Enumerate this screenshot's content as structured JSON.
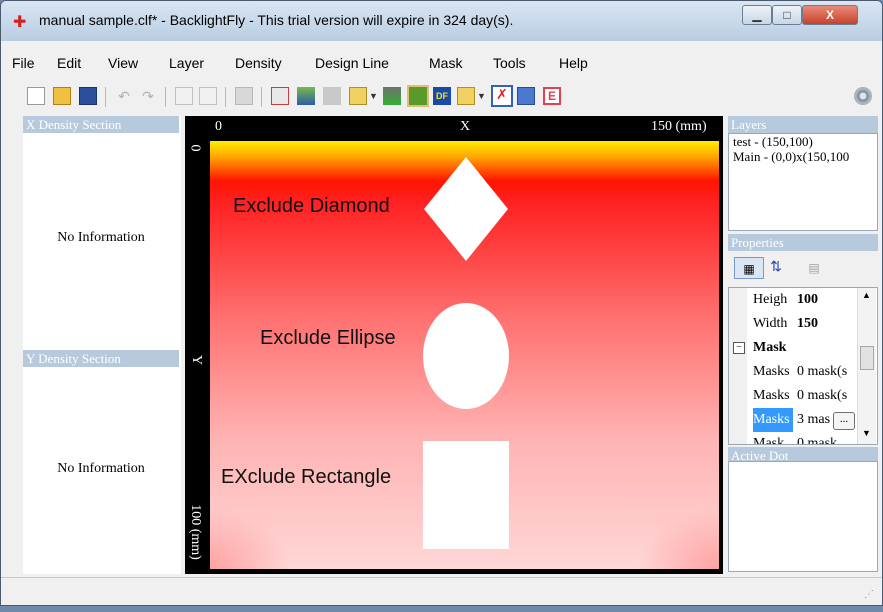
{
  "window": {
    "title": "manual sample.clf* - BacklightFly - This trial version will expire in 324 day(s).",
    "controls": {
      "minimize": "▁",
      "maximize": "□",
      "close": "X"
    }
  },
  "menu": [
    "File",
    "Edit",
    "View",
    "Layer",
    "Density",
    "Design Line",
    "Mask",
    "Tools",
    "Help"
  ],
  "left_panel": {
    "x_section_title": "X Density Section",
    "x_section_text": "No Information",
    "y_section_title": "Y Density Section",
    "y_section_text": "No Information"
  },
  "canvas": {
    "x_ruler": {
      "start": "0",
      "label": "X",
      "end": "150 (mm)"
    },
    "y_ruler": {
      "start": "0",
      "label": "Y",
      "end": "100 (mm)"
    },
    "shapes": {
      "diamond_label": "Exclude Diamond",
      "ellipse_label": "Exclude Ellipse",
      "rectangle_label": "EXclude Rectangle"
    }
  },
  "layers": {
    "title": "Layers",
    "items": [
      "test - (150,100)",
      "Main - (0,0)x(150,100"
    ]
  },
  "properties": {
    "title": "Properties",
    "rows": [
      {
        "name": "Heigh",
        "value": "100"
      },
      {
        "name": "Width",
        "value": "150"
      },
      {
        "category": "Mask"
      },
      {
        "name": "Masks",
        "value": "0 mask(s"
      },
      {
        "name": "Masks",
        "value": "0 mask(s"
      },
      {
        "name": "Masks",
        "value": "3 mas"
      },
      {
        "name": "Mask",
        "value": "0 mask"
      }
    ],
    "ellipsis_button": "..."
  },
  "active_dot": {
    "title": "Active Dot"
  }
}
